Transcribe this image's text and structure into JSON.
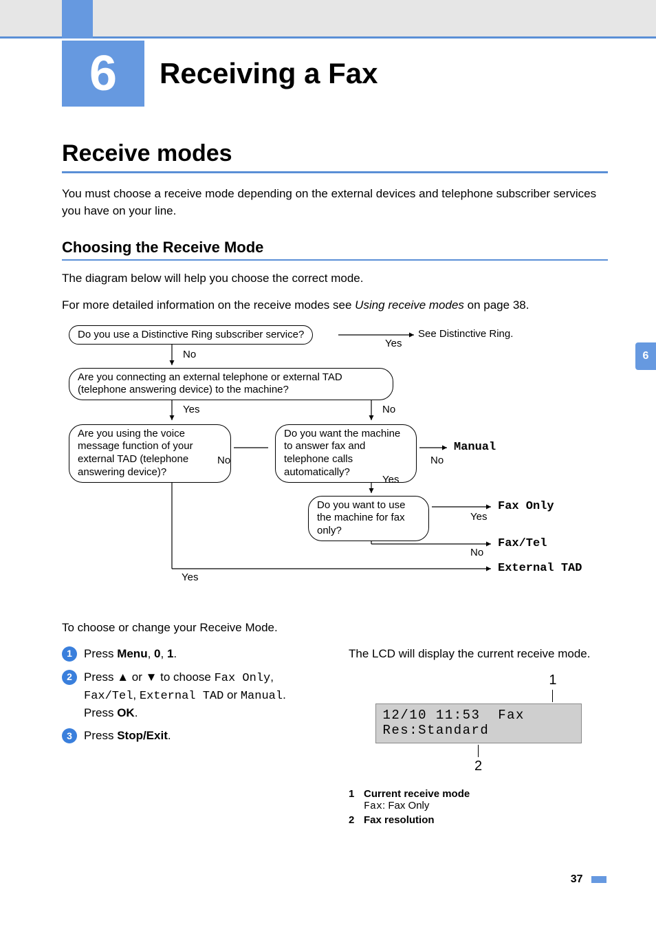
{
  "chapter": {
    "number": "6",
    "title": "Receiving a Fax"
  },
  "section": {
    "title": "Receive modes",
    "intro": "You must choose a receive mode depending on the external devices and telephone subscriber services you have on your line."
  },
  "subsection": {
    "title": "Choosing the Receive Mode",
    "p1": "The diagram below will help you choose the correct mode.",
    "p2_pre": "For more detailed information on the receive modes see ",
    "p2_link": "Using receive modes",
    "p2_post": " on page 38."
  },
  "diagram": {
    "q1": "Do you use a Distinctive Ring subscriber service?",
    "q1_result": "See Distinctive Ring.",
    "q2": "Are you connecting an external telephone or external TAD (telephone answering device) to the machine?",
    "q3": "Are you using the voice message function of your external TAD (telephone answering device)?",
    "q4": "Do you want the machine to answer fax and telephone calls automatically?",
    "q5": "Do you want to use the machine for fax only?",
    "r_manual": "Manual",
    "r_faxonly": "Fax Only",
    "r_faxtel": "Fax/Tel",
    "r_exttad": "External TAD",
    "yes": "Yes",
    "no": "No"
  },
  "steps": {
    "intro": "To choose or change your Receive Mode.",
    "s1_pre": "Press ",
    "s1_menu": "Menu",
    "s1_sep1": ", ",
    "s1_k0": "0",
    "s1_sep2": ", ",
    "s1_k1": "1",
    "s1_end": ".",
    "s2_pre": "Press ",
    "s2_mid": " or ",
    "s2_post": " to choose ",
    "s2_opt1": "Fax Only",
    "s2_c1": ", ",
    "s2_opt2": "Fax/Tel",
    "s2_c2": ", ",
    "s2_opt3": "External TAD",
    "s2_or": " or ",
    "s2_opt4": "Manual",
    "s2_end": ".",
    "s2_press": "Press ",
    "s2_ok": "OK",
    "s2_pend": ".",
    "s3_pre": "Press ",
    "s3_btn": "Stop/Exit",
    "s3_end": "."
  },
  "rightcol": {
    "intro": "The LCD will display the current receive mode.",
    "lcd_line1": "12/10 11:53  Fax",
    "lcd_line2": "Res:Standard",
    "callout1": "1",
    "callout2": "2",
    "legend1_title": "Current receive mode",
    "legend1_code": "Fax",
    "legend1_desc": ": Fax Only",
    "legend2_title": "Fax resolution"
  },
  "page": {
    "tab": "6",
    "number": "37"
  }
}
